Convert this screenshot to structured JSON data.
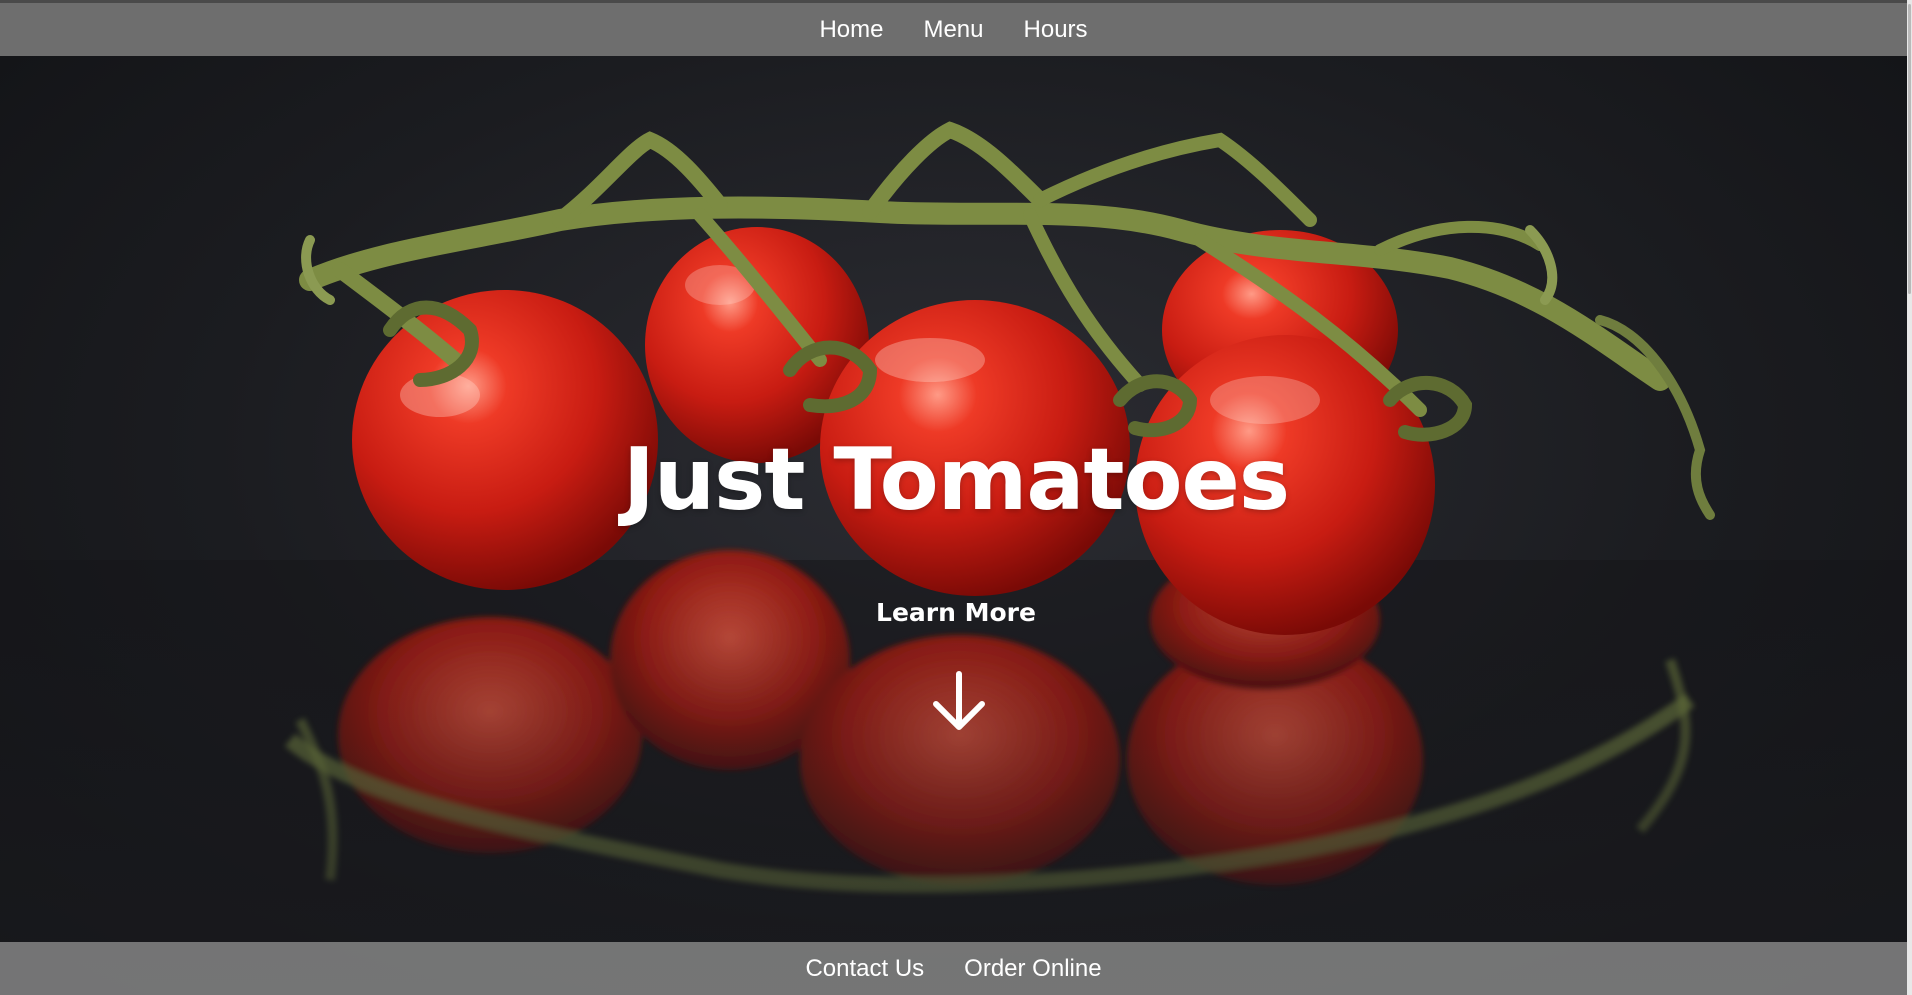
{
  "nav": {
    "top_links": [
      "Home",
      "Menu",
      "Hours"
    ],
    "bottom_links": [
      "Contact Us",
      "Order Online"
    ]
  },
  "hero": {
    "title": "Just Tomatoes",
    "learn_more": "Learn More",
    "arrow_icon": "arrow-down-icon",
    "image_subject": "cherry tomatoes on the vine with reflection"
  },
  "colors": {
    "nav_bg": "#6e6e6e",
    "text": "#ffffff",
    "background": "#1a1b1f",
    "tomato": "#d8261c",
    "vine": "#6f7d3e"
  }
}
